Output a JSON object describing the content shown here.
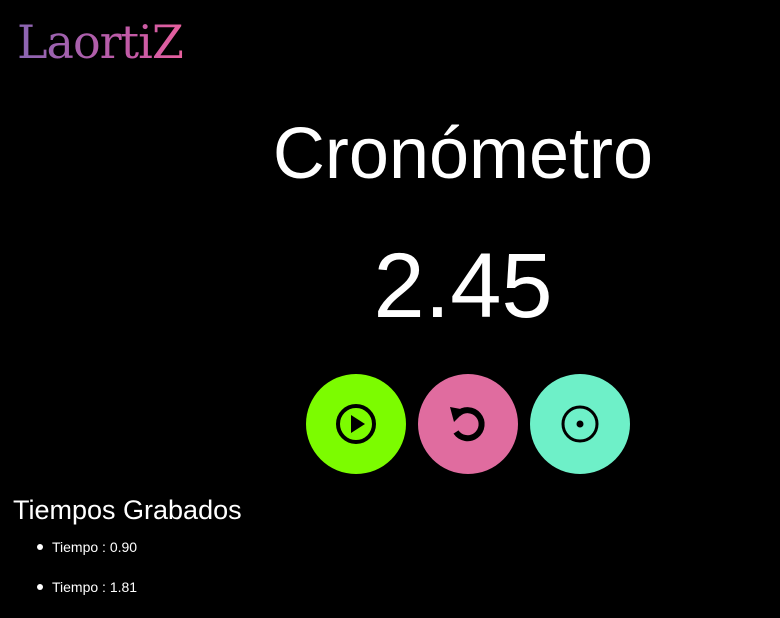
{
  "header": {
    "logo_text": "LaortiZ"
  },
  "main": {
    "title": "Cronómetro",
    "timer_value": "2.45"
  },
  "controls": {
    "play": {
      "icon": "play-circle-icon",
      "color": "#7cfc00"
    },
    "reset": {
      "icon": "reset-arrow-icon",
      "color": "#e06c9f"
    },
    "record": {
      "icon": "record-target-icon",
      "color": "#6ef0c8"
    }
  },
  "recorded": {
    "title": "Tiempos Grabados",
    "items": [
      {
        "label": "Tiempo : 0.90"
      },
      {
        "label": "Tiempo : 1.81"
      }
    ]
  }
}
